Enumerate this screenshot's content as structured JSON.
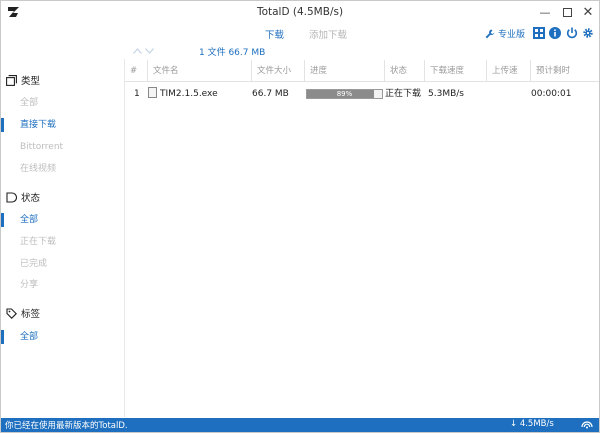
{
  "window": {
    "title": "TotalD (4.5MB/s)"
  },
  "tabs": {
    "download": "下载",
    "add": "添加下载"
  },
  "toolbar": {
    "pro_label": "专业版"
  },
  "subbar": {
    "count": "1 文件  66.7 MB"
  },
  "sidebar": {
    "type": {
      "title": "类型",
      "items": [
        "全部",
        "直接下载",
        "Bittorrent",
        "在线视频"
      ]
    },
    "status": {
      "title": "状态",
      "items": [
        "全部",
        "正在下载",
        "已完成",
        "分享"
      ]
    },
    "tags": {
      "title": "标签",
      "items": [
        "全部"
      ]
    }
  },
  "table": {
    "headers": [
      "#",
      "文件名",
      "文件大小",
      "进度",
      "状态",
      "下载速度",
      "上传速",
      "预计剩时"
    ],
    "rows": [
      {
        "index": "1",
        "name": "TIM2.1.5.exe",
        "size": "66.7 MB",
        "progress_text": "89%",
        "progress": 0.89,
        "status": "正在下载",
        "speed": "5.3MB/s",
        "upload": "",
        "eta": "00:00:01"
      }
    ]
  },
  "statusbar": {
    "message": "你已经在使用最新版本的TotalD.",
    "speed": "↓ 4.5MB/s"
  },
  "colors": {
    "accent": "#1e6fbf",
    "muted": "#bdbdbd",
    "progress_fill": "#8b8b8b"
  },
  "icons": [
    "app-logo",
    "minimize-icon",
    "maximize-icon",
    "close-icon",
    "wrench-icon",
    "grid-icon",
    "info-icon",
    "power-icon",
    "gear-icon",
    "up-arrow-icon",
    "down-arrow-icon",
    "type-icon",
    "status-icon",
    "tag-icon",
    "file-icon",
    "network-icon"
  ]
}
